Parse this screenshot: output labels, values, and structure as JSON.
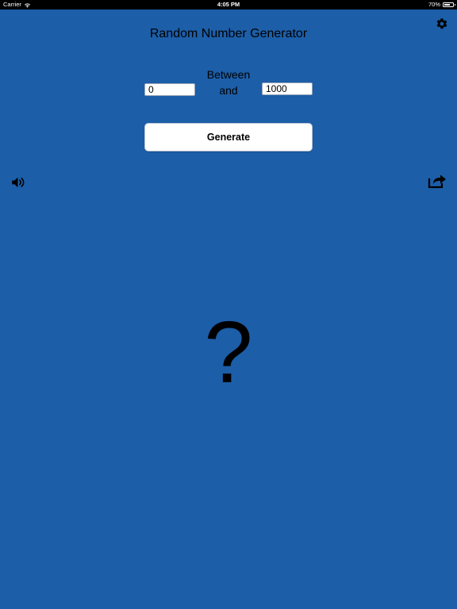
{
  "status_bar": {
    "carrier": "Carrier",
    "time": "4:05 PM",
    "battery_percent": "70%",
    "battery_level": 0.7
  },
  "header": {
    "title": "Random Number Generator",
    "settings_icon": "gear-icon"
  },
  "range": {
    "between_label": "Between",
    "and_label": "and",
    "min_value": "0",
    "max_value": "1000"
  },
  "actions": {
    "generate_label": "Generate",
    "sound_icon": "speaker-icon",
    "share_icon": "share-icon"
  },
  "result": {
    "value": "?"
  },
  "colors": {
    "background": "#1c5ea8",
    "text": "#000000",
    "button_bg": "#ffffff"
  }
}
